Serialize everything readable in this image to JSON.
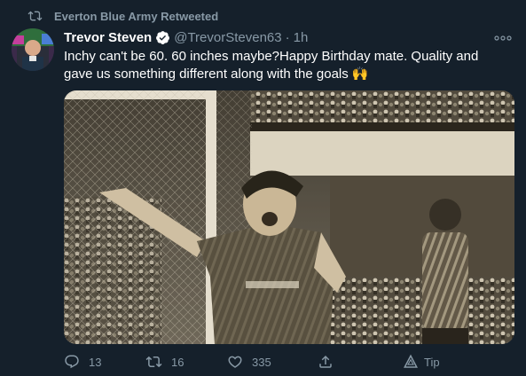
{
  "retweet": {
    "icon": "retweet-icon",
    "text": "Everton Blue Army Retweeted"
  },
  "author": {
    "avatar_icon": "avatar",
    "name": "Trevor Steven",
    "verified_icon": "verified-badge-icon",
    "handle": "@TrevorSteven63",
    "separator": "·",
    "time": "1h"
  },
  "more_menu": {
    "icon": "more-options-icon",
    "label": "ooo"
  },
  "tweet": {
    "line1": "Inchy can't be 60. 60 inches maybe?Happy Birthday mate. Quality and",
    "line2": "gave us something different along with the goals 🙌"
  },
  "media": {
    "type": "photo",
    "description_icon": "football-celebration-photo"
  },
  "actions": {
    "reply": {
      "icon": "reply-icon",
      "count": "13"
    },
    "retweet": {
      "icon": "retweet-icon",
      "count": "16"
    },
    "like": {
      "icon": "heart-icon",
      "count": "335"
    },
    "share": {
      "icon": "share-icon",
      "count": ""
    },
    "tip": {
      "icon": "tip-icon",
      "label": "Tip"
    }
  },
  "colors": {
    "background": "#15202b",
    "secondary_text": "#8899a6",
    "verified": "#ffffff"
  }
}
